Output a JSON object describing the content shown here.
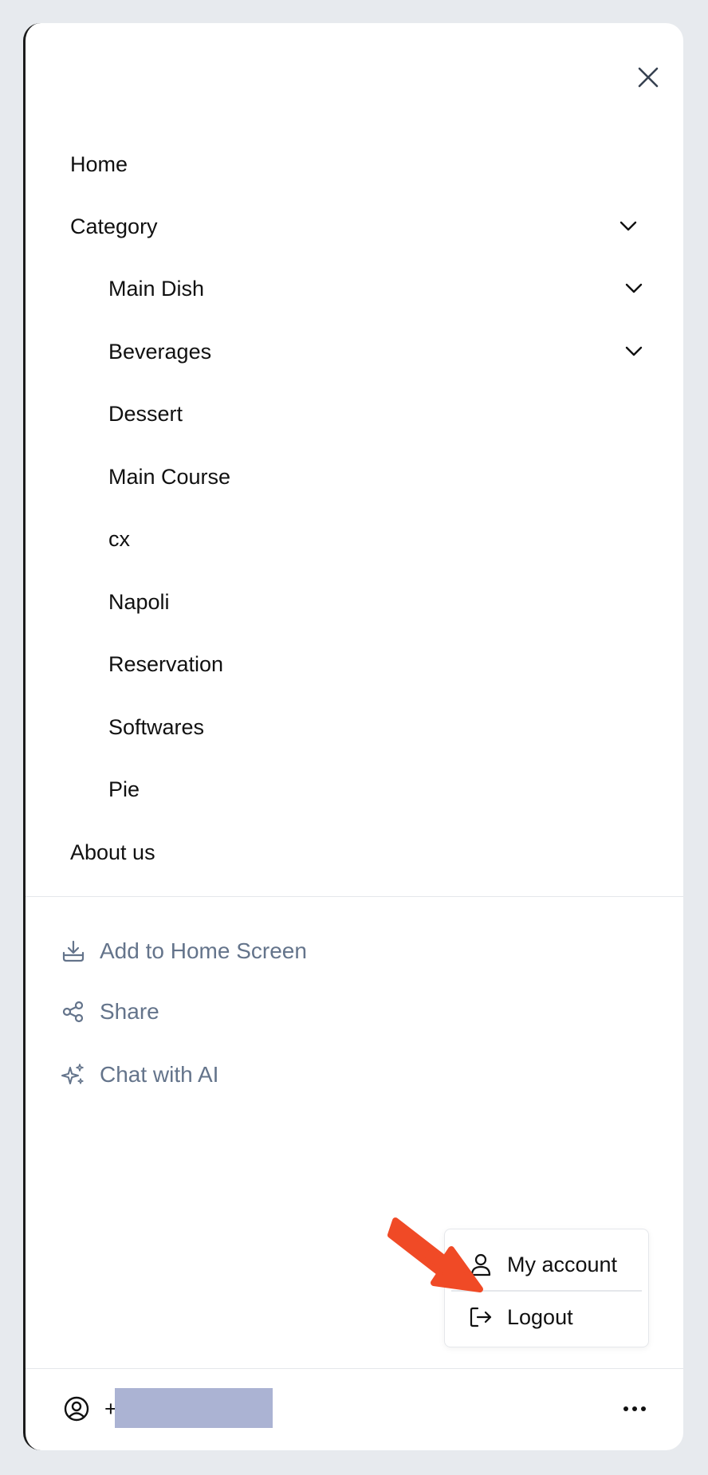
{
  "menu": {
    "home": "Home",
    "category": "Category",
    "subcategories": [
      "Main Dish",
      "Beverages",
      "Dessert",
      "Main Course",
      "cx",
      "Napoli",
      "Reservation",
      "Softwares",
      "Pie"
    ],
    "about": "About us"
  },
  "actions": {
    "add_home": "Add to Home Screen",
    "share": "Share",
    "chat_ai": "Chat with AI"
  },
  "account_menu": {
    "my_account": "My account",
    "logout": "Logout"
  },
  "footer": {
    "user_prefix": "+"
  },
  "colors": {
    "annotation_arrow": "#f04a26",
    "muted_text": "#64748b",
    "redaction": "#abb3d3"
  },
  "icons": {
    "close": "close-icon",
    "chevron": "chevron-down-icon",
    "download": "download-icon",
    "share": "share-icon",
    "sparkles": "sparkles-icon",
    "user": "user-icon",
    "logout": "logout-icon",
    "user_circle": "user-circle-icon",
    "more": "more-horizontal-icon"
  }
}
